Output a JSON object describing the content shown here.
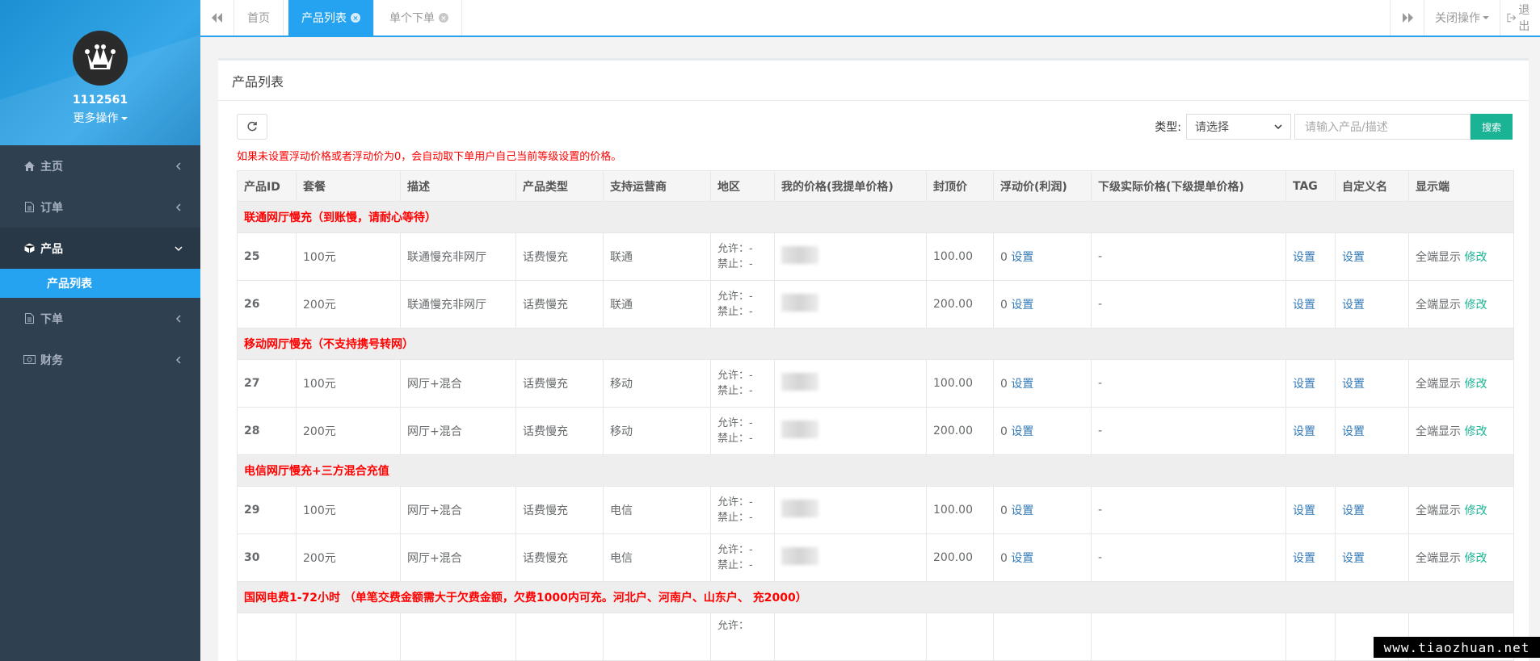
{
  "profile": {
    "username": "1112561",
    "more_ops": "更多操作"
  },
  "sidebar": {
    "items": [
      {
        "label": "主页",
        "icon": "home-icon"
      },
      {
        "label": "订单",
        "icon": "file-icon"
      },
      {
        "label": "产品",
        "icon": "cube-icon"
      },
      {
        "label": "下单",
        "icon": "file-icon"
      },
      {
        "label": "财务",
        "icon": "money-icon"
      }
    ],
    "sub_active": "产品列表"
  },
  "tabs": [
    {
      "label": "首页"
    },
    {
      "label": "产品列表"
    },
    {
      "label": "单个下单"
    }
  ],
  "right_tools": {
    "close_ops": "关闭操作",
    "logout": "退出"
  },
  "panel": {
    "title": "产品列表"
  },
  "filter": {
    "label": "类型:",
    "select_value": "请选择",
    "placeholder": "请输入产品/描述",
    "search": "搜索"
  },
  "notice": "如果未设置浮动价格或者浮动价为0，会自动取下单用户自己当前等级设置的价格。",
  "table": {
    "headers": [
      "产品ID",
      "套餐",
      "描述",
      "产品类型",
      "支持运营商",
      "地区",
      "我的价格(我提单价格)",
      "封顶价",
      "浮动价(利润)",
      "下级实际价格(下级提单价格)",
      "TAG",
      "自定义名",
      "显示端"
    ],
    "region_allow": "允许：-",
    "region_deny": "禁止：-",
    "float_value": "0",
    "set_label": "设置",
    "lower_price": "-",
    "display_text": "全端显示",
    "modify_label": "修改",
    "groups": [
      {
        "title": "联通网厅慢充（到账慢，请耐心等待）",
        "rows": [
          {
            "id": "25",
            "package": "100元",
            "desc": "联通慢充非网厅",
            "type": "话费慢充",
            "carrier": "联通",
            "cap": "100.00"
          },
          {
            "id": "26",
            "package": "200元",
            "desc": "联通慢充非网厅",
            "type": "话费慢充",
            "carrier": "联通",
            "cap": "200.00"
          }
        ]
      },
      {
        "title": "移动网厅慢充（不支持携号转网）",
        "rows": [
          {
            "id": "27",
            "package": "100元",
            "desc": "网厅+混合",
            "type": "话费慢充",
            "carrier": "移动",
            "cap": "100.00"
          },
          {
            "id": "28",
            "package": "200元",
            "desc": "网厅+混合",
            "type": "话费慢充",
            "carrier": "移动",
            "cap": "200.00"
          }
        ]
      },
      {
        "title": "电信网厅慢充+三方混合充值",
        "rows": [
          {
            "id": "29",
            "package": "100元",
            "desc": "网厅+混合",
            "type": "话费慢充",
            "carrier": "电信",
            "cap": "100.00"
          },
          {
            "id": "30",
            "package": "200元",
            "desc": "网厅+混合",
            "type": "话费慢充",
            "carrier": "电信",
            "cap": "200.00"
          }
        ]
      },
      {
        "title": "国网电费1-72小时 （单笔交费金额需大于欠费金额，欠费1000内可充。河北户、河南户、山东户、        充2000）",
        "rows": []
      }
    ],
    "partial_region": "允许："
  },
  "watermark": "www.tiaozhuan.net",
  "colors": {
    "sidebar_bg": "#2f4050",
    "accent": "#26a3f0",
    "green": "#1ab394",
    "red": "#ff0000",
    "link": "#337ab7"
  }
}
